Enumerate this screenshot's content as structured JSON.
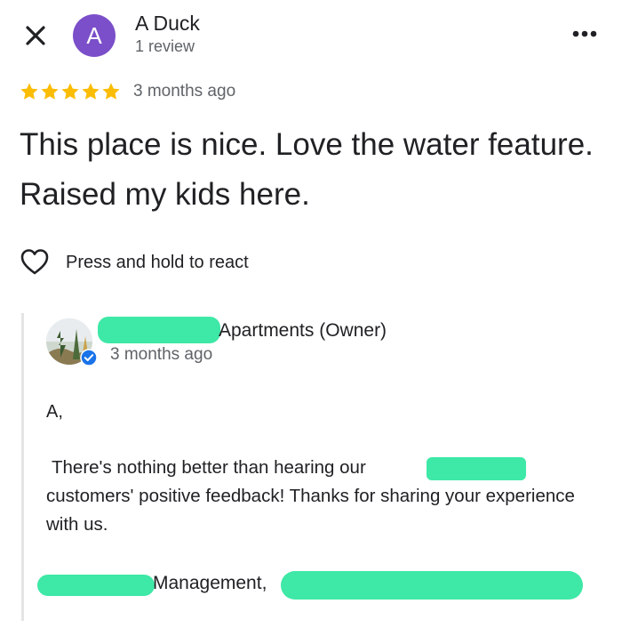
{
  "header": {
    "avatar_letter": "A",
    "avatar_color": "#7b4fc9",
    "reviewer_name": "A Duck",
    "review_count": "1 review",
    "close_icon": "close-icon",
    "more_icon": "more-horizontal-icon"
  },
  "rating": {
    "stars": 5,
    "max_stars": 5,
    "star_color": "#fbbc04",
    "date": "3 months ago"
  },
  "review": {
    "text": "This place is nice.  Love the water feature.  Raised my kids here."
  },
  "react": {
    "label": "Press and hold to react",
    "icon": "heart-outline-icon"
  },
  "owner_reply": {
    "name_suffix": "Apartments (Owner)",
    "date": "3 months ago",
    "greeting": "A,",
    "body_line1_prefix": "There's nothing better than hearing our",
    "body_rest": "customers' positive feedback! Thanks for sharing your experience with us.",
    "sign_off": "Management,",
    "redaction_color": "#3ee8a6"
  }
}
